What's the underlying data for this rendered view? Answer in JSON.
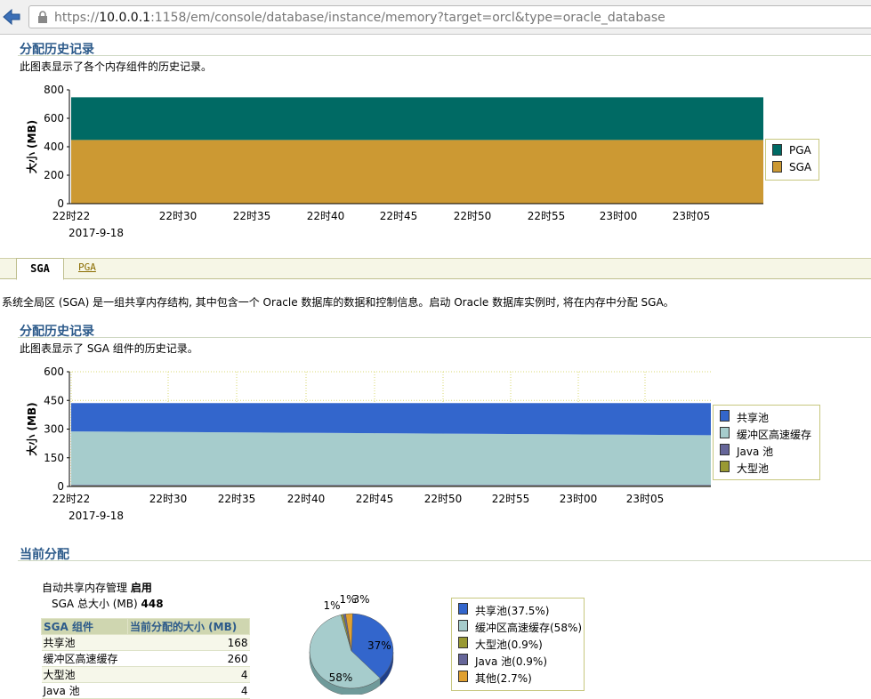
{
  "browser": {
    "url_prefix": "https://",
    "url_host": "10.0.0.1",
    "url_rest": ":1158/em/console/database/instance/memory?target=orcl&type=oracle_database"
  },
  "section1": {
    "title": "分配历史记录",
    "description": "此图表显示了各个内存组件的历史记录。"
  },
  "section2": {
    "title": "分配历史记录",
    "description": "此图表显示了 SGA 组件的历史记录。"
  },
  "section3": {
    "title": "当前分配"
  },
  "tabs": {
    "active": "SGA",
    "other": "PGA"
  },
  "sga_description": "系统全局区 (SGA) 是一组共享内存结构, 其中包含一个 Oracle 数据库的数据和控制信息。启动 Oracle 数据库实例时, 将在内存中分配 SGA。",
  "asmm": {
    "label": "自动共享内存管理",
    "value": "启用"
  },
  "sga_total": {
    "label": "SGA 总大小 (MB)",
    "value": "448"
  },
  "colors": {
    "pga": "#006a64",
    "sga": "#cc9933",
    "shared_pool": "#3366cc",
    "buffer_cache": "#a6cccc",
    "java_pool": "#666699",
    "large_pool": "#999933",
    "other": "#e0a030"
  },
  "chart_data": [
    {
      "type": "area",
      "ylabel": "大小 (MB)",
      "ylim": [
        0,
        800
      ],
      "yticks": [
        "0",
        "200",
        "400",
        "600",
        "800"
      ],
      "xticks": [
        "22时22",
        "22时30",
        "22时35",
        "22时40",
        "22时45",
        "22时50",
        "22时55",
        "23时00",
        "23时05"
      ],
      "date_label": "2017-9-18",
      "stacked": true,
      "x": [
        "22:22",
        "23:10"
      ],
      "series": [
        {
          "name": "SGA",
          "values": [
            448,
            448
          ]
        },
        {
          "name": "PGA",
          "values": [
            300,
            300
          ]
        }
      ],
      "legend": [
        "PGA",
        "SGA"
      ]
    },
    {
      "type": "area",
      "ylabel": "大小 (MB)",
      "ylim": [
        0,
        600
      ],
      "yticks": [
        "0",
        "150",
        "300",
        "450",
        "600"
      ],
      "xticks": [
        "22时22",
        "22时30",
        "22时35",
        "22时40",
        "22时45",
        "22时50",
        "22时55",
        "23时00",
        "23时05"
      ],
      "date_label": "2017-9-18",
      "stacked": true,
      "x": [
        "22:22",
        "23:10"
      ],
      "series": [
        {
          "name": "大型池",
          "values": [
            4,
            4
          ]
        },
        {
          "name": "Java 池",
          "values": [
            4,
            4
          ]
        },
        {
          "name": "缓冲区高速缓存",
          "values": [
            280,
            260
          ]
        },
        {
          "name": "共享池",
          "values": [
            148,
            168
          ]
        }
      ],
      "legend": [
        "共享池",
        "缓冲区高速缓存",
        "Java 池",
        "大型池"
      ]
    },
    {
      "type": "pie",
      "slices": [
        {
          "name": "共享池",
          "value": 37.5,
          "label": "37%"
        },
        {
          "name": "缓冲区高速缓存",
          "value": 58,
          "label": "58%"
        },
        {
          "name": "大型池",
          "value": 0.9,
          "label": "1%"
        },
        {
          "name": "Java 池",
          "value": 0.9,
          "label": "1%"
        },
        {
          "name": "其他",
          "value": 2.7,
          "label": "3%"
        }
      ],
      "legend": [
        "共享池(37.5%)",
        "缓冲区高速缓存(58%)",
        "大型池(0.9%)",
        "Java 池(0.9%)",
        "其他(2.7%)"
      ]
    },
    {
      "type": "table",
      "columns": [
        "SGA 组件",
        "当前分配的大小 (MB)"
      ],
      "rows": [
        [
          "共享池",
          "168"
        ],
        [
          "缓冲区高速缓存",
          "260"
        ],
        [
          "大型池",
          "4"
        ],
        [
          "Java 池",
          "4"
        ]
      ]
    }
  ]
}
